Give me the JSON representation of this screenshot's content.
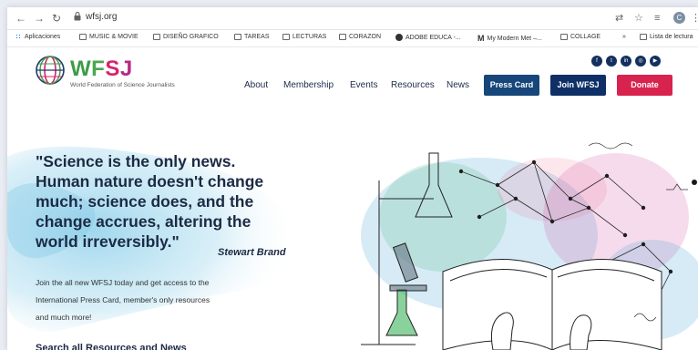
{
  "browser": {
    "url": "wfsj.org",
    "bookmarks": [
      {
        "label": "Aplicaciones",
        "icon": "apps-grid-icon"
      },
      {
        "label": "MUSIC & MOVIE",
        "icon": "folder-icon"
      },
      {
        "label": "DISEÑO GRAFICO",
        "icon": "folder-icon"
      },
      {
        "label": "TAREAS",
        "icon": "folder-icon"
      },
      {
        "label": "LECTURAS",
        "icon": "folder-icon"
      },
      {
        "label": "CORAZON",
        "icon": "folder-icon"
      },
      {
        "label": "ADOBE EDUCA -...",
        "icon": "globe-icon"
      },
      {
        "label": "My Modern Met –...",
        "icon": "mymodernmet-icon"
      },
      {
        "label": "COLLAGE",
        "icon": "folder-icon"
      },
      {
        "label": "Lista de lectura",
        "icon": "reading-list-icon"
      }
    ],
    "overflow": "»",
    "profile_initial": "C"
  },
  "site": {
    "logo": {
      "w": "W",
      "f": "F",
      "s": "S",
      "j": "J",
      "tagline": "World Federation of Science Journalists"
    },
    "social_icons": [
      "facebook-icon",
      "twitter-icon",
      "linkedin-icon",
      "instagram-icon",
      "youtube-icon"
    ],
    "social_glyphs": [
      "f",
      "t",
      "in",
      "◎",
      "▶"
    ],
    "nav": [
      "About",
      "Membership",
      "Events",
      "Resources",
      "News"
    ],
    "buttons": {
      "press_card": "Press Card",
      "join": "Join WFSJ",
      "donate": "Donate"
    },
    "colors": {
      "navy": "#0f3066",
      "donate": "#d8234e",
      "text": "#1c2a44",
      "green": "#3e9b48",
      "magenta": "#d6246b"
    }
  },
  "hero": {
    "quote_lines": [
      "\"Science is the only news.",
      "Human nature doesn't change",
      "much; science does, and the",
      "change accrues, altering the",
      "world irreversibly.\""
    ],
    "author": "Stewart Brand",
    "lead_lines": [
      "Join the all new WFSJ today and get access to the",
      "International Press Card, member's only resources",
      "and much more!"
    ],
    "search_heading": "Search all Resources and News"
  }
}
